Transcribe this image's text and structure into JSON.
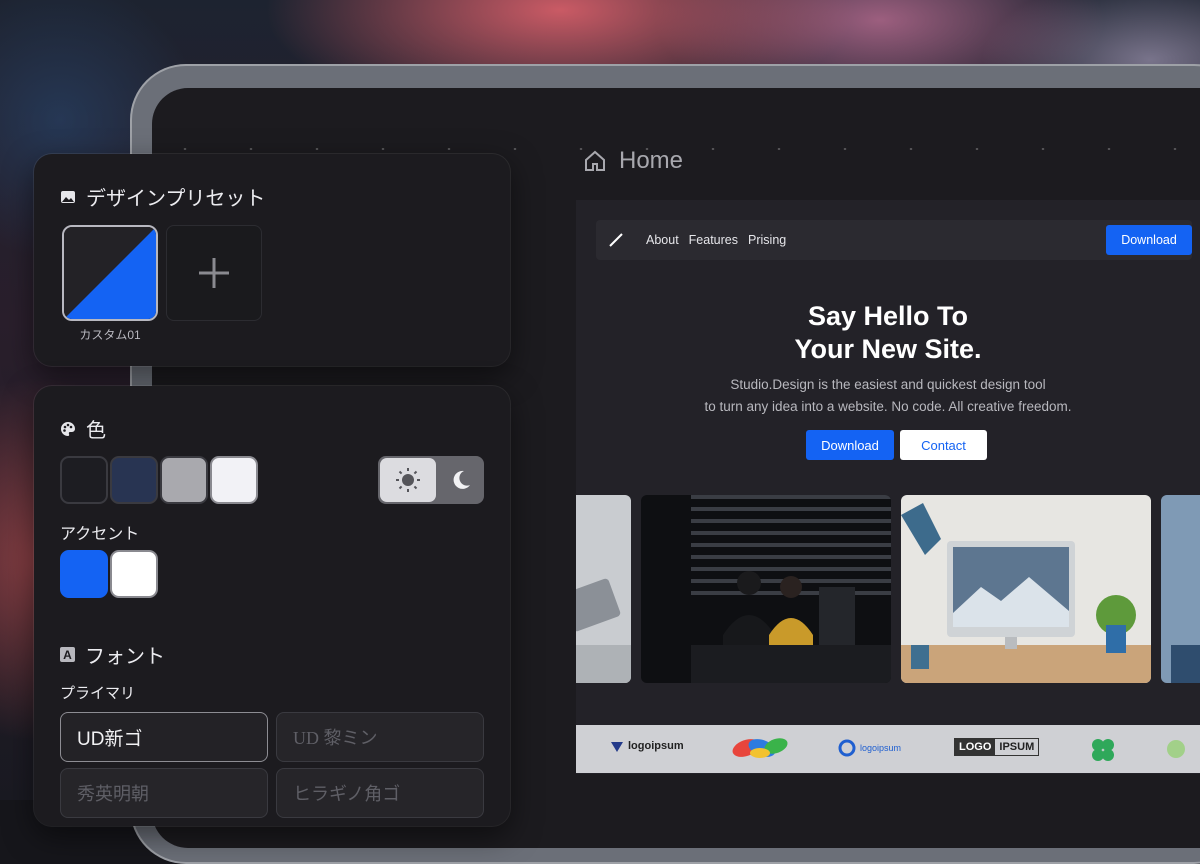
{
  "home": {
    "title": "Home"
  },
  "preview": {
    "nav_links": [
      "About",
      "Features",
      "Prising"
    ],
    "nav_download": "Download",
    "hero_title_line1": "Say Hello To",
    "hero_title_line2": "Your New Site.",
    "hero_sub_line1": "Studio.Design is the easiest and quickest design tool",
    "hero_sub_line2": "to turn any idea into a website. No code. All creative freedom.",
    "hero_download": "Download",
    "hero_contact": "Contact",
    "logos": [
      "logoipsum",
      "logoipsum",
      "LOGO",
      "IPSUM"
    ]
  },
  "presets_panel": {
    "title": "デザインプリセット",
    "preset_label": "カスタム01"
  },
  "style_panel": {
    "color_title": "色",
    "accent_label": "アクセント",
    "font_title": "フォント",
    "primary_label": "プライマリ",
    "fonts": [
      "UD新ゴ",
      "UD 黎ミン",
      "秀英明朝",
      "ヒラギノ角ゴ"
    ],
    "font_icon_letter": "A"
  },
  "colors": {
    "swatches": [
      "#1d1d22",
      "#283452",
      "#a9a9ae",
      "#f2f2f6"
    ],
    "accent": [
      "#1463f3",
      "#ffffff"
    ],
    "brand_blue": "#1463f3"
  }
}
